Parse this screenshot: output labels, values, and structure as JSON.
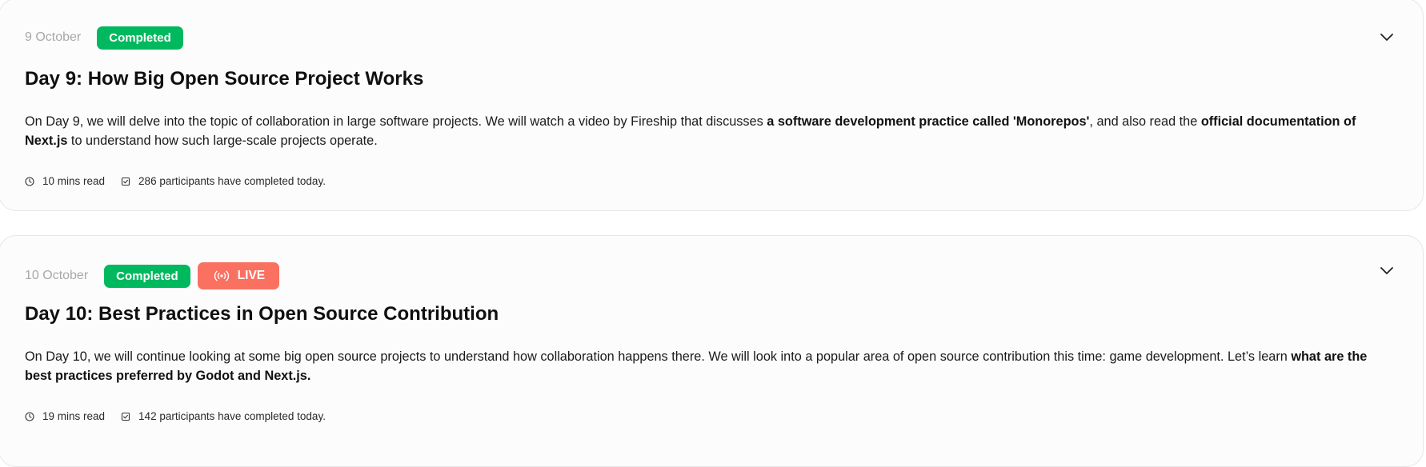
{
  "cards": [
    {
      "date": "9 October",
      "badges": {
        "completed": "Completed"
      },
      "title": "Day 9: How Big Open Source Project Works",
      "description": {
        "part1": "On Day 9, we will delve into the topic of collaboration in large software projects. We will watch a video by Fireship that discusses ",
        "bold1": "a software development practice called 'Monorepos'",
        "part2": ", and also read the ",
        "bold2": "official documentation of Next.js",
        "part3": " to understand how such large-scale projects operate."
      },
      "meta": {
        "read_time": "10 mins read",
        "participants": "286 participants have completed today."
      }
    },
    {
      "date": "10 October",
      "badges": {
        "completed": "Completed",
        "live": "LIVE"
      },
      "title": "Day 10: Best Practices in Open Source Contribution",
      "description": {
        "part1": "On Day 10, we will continue looking at some big open source projects to understand how collaboration happens there. We will look into a popular area of open source contribution this time: game development. Let’s learn ",
        "bold1": "what are the best practices preferred by Godot and Next.js."
      },
      "meta": {
        "read_time": "19 mins read",
        "participants": "142 participants have completed today."
      }
    }
  ],
  "colors": {
    "completed_badge": "#00b95f",
    "live_badge": "#fa7061",
    "date_text": "#a8a8a8"
  },
  "icons": [
    "chevron-down-icon",
    "clock-icon",
    "check-square-icon",
    "broadcast-icon"
  ]
}
